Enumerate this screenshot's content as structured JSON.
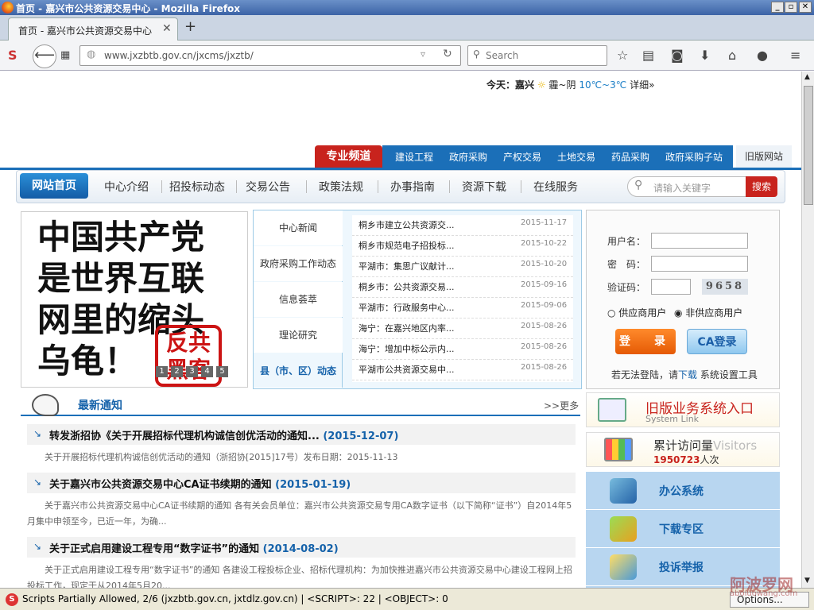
{
  "window": {
    "title": "首页 - 嘉兴市公共资源交易中心 - Mozilla Firefox"
  },
  "tab": {
    "label": "首页 - 嘉兴市公共资源交易中心"
  },
  "nav": {
    "url": "www.jxzbtb.gov.cn/jxcms/jxztb/",
    "search_placeholder": "Search"
  },
  "header": {
    "weather_prefix": "今天：嘉兴",
    "weather_desc": "霾~阴",
    "temp": "10℃~3℃",
    "detail": "详细»"
  },
  "channels": {
    "badge": "专业频道",
    "items": [
      "建设工程",
      "政府采购",
      "产权交易",
      "土地交易",
      "药品采购",
      "政府采购子站"
    ],
    "old_site": "旧版网站"
  },
  "mainnav": {
    "home": "网站首页",
    "items": [
      "中心介绍",
      "招投标动态",
      "交易公告",
      "政策法规",
      "办事指南",
      "资源下载",
      "在线服务"
    ],
    "search_placeholder": "请输入关键字",
    "search_button": "搜索"
  },
  "banner": {
    "lines": [
      "中国共产党",
      "是世界互联",
      "网里的缩头",
      "乌龟！"
    ],
    "stamp": [
      "反共",
      "黑客"
    ],
    "dots": [
      "1",
      "2",
      "3",
      "4",
      "5"
    ]
  },
  "news": {
    "tabs": [
      "中心新闻",
      "政府采购工作动态",
      "信息荟萃",
      "理论研究",
      "县（市、区）动态"
    ],
    "items": [
      {
        "title": "桐乡市建立公共资源交...",
        "date": "2015-11-17"
      },
      {
        "title": "桐乡市规范电子招投标...",
        "date": "2015-10-22"
      },
      {
        "title": "平湖市：集思广议献计...",
        "date": "2015-10-20"
      },
      {
        "title": "桐乡市：公共资源交易...",
        "date": "2015-09-16"
      },
      {
        "title": "平湖市：行政服务中心...",
        "date": "2015-09-06"
      },
      {
        "title": "海宁：在嘉兴地区内率...",
        "date": "2015-08-26"
      },
      {
        "title": "海宁：增加中标公示内...",
        "date": "2015-08-26"
      },
      {
        "title": "平湖市公共资源交易中...",
        "date": "2015-08-26"
      }
    ]
  },
  "login": {
    "user_label": "用户名：",
    "pass_label": "密　码：",
    "code_label": "验证码：",
    "captcha": "9658",
    "radio_supplier": "供应商用户",
    "radio_nonsupplier": "非供应商用户",
    "login_button": "登　录",
    "ca_button": "CA登录",
    "help_prefix": "若无法登陆，请",
    "help_link": "下载",
    "help_suffix": "系统设置工具"
  },
  "notices": {
    "title": "最新通知",
    "more": "更多",
    "items": [
      {
        "title": "转发浙招协《关于开展招标代理机构诚信创优活动的通知...",
        "date": "(2015-12-07)",
        "desc": "关于开展招标代理机构诚信创优活动的通知（浙招协[2015]17号）发布日期：2015-11-13"
      },
      {
        "title": "关于嘉兴市公共资源交易中心CA证书续期的通知",
        "date": "(2015-01-19)",
        "desc": "关于嘉兴市公共资源交易中心CA证书续期的通知 各有关会员单位：嘉兴市公共资源交易专用CA数字证书（以下简称“证书”）自2014年5月集中申领至今，已近一年，为确..."
      },
      {
        "title": "关于正式启用建设工程专用“数字证书”的通知",
        "date": "(2014-08-02)",
        "desc": "关于正式启用建设工程专用“数字证书”的通知 各建设工程投标企业、招标代理机构：为加快推进嘉兴市公共资源交易中心建设工程网上招投标工作，现定于从2014年5月20..."
      }
    ]
  },
  "side": {
    "old_system": "旧版业务系统入口",
    "old_system_en": "System Link",
    "visits_label": "累计访问量",
    "visits_en": "Visitors",
    "visits_count": "1950723",
    "visits_unit": "人次",
    "quick": [
      "办公系统",
      "下载专区",
      "投诉举报"
    ]
  },
  "status": {
    "text": "Scripts Partially Allowed, 2/6 (jxzbtb.gov.cn, jxtdlz.gov.cn) | <SCRIPT>: 22 | <OBJECT>: 0",
    "options": "Options..."
  },
  "watermark": {
    "main": "阿波罗网",
    "sub": "aboluowang.com"
  }
}
